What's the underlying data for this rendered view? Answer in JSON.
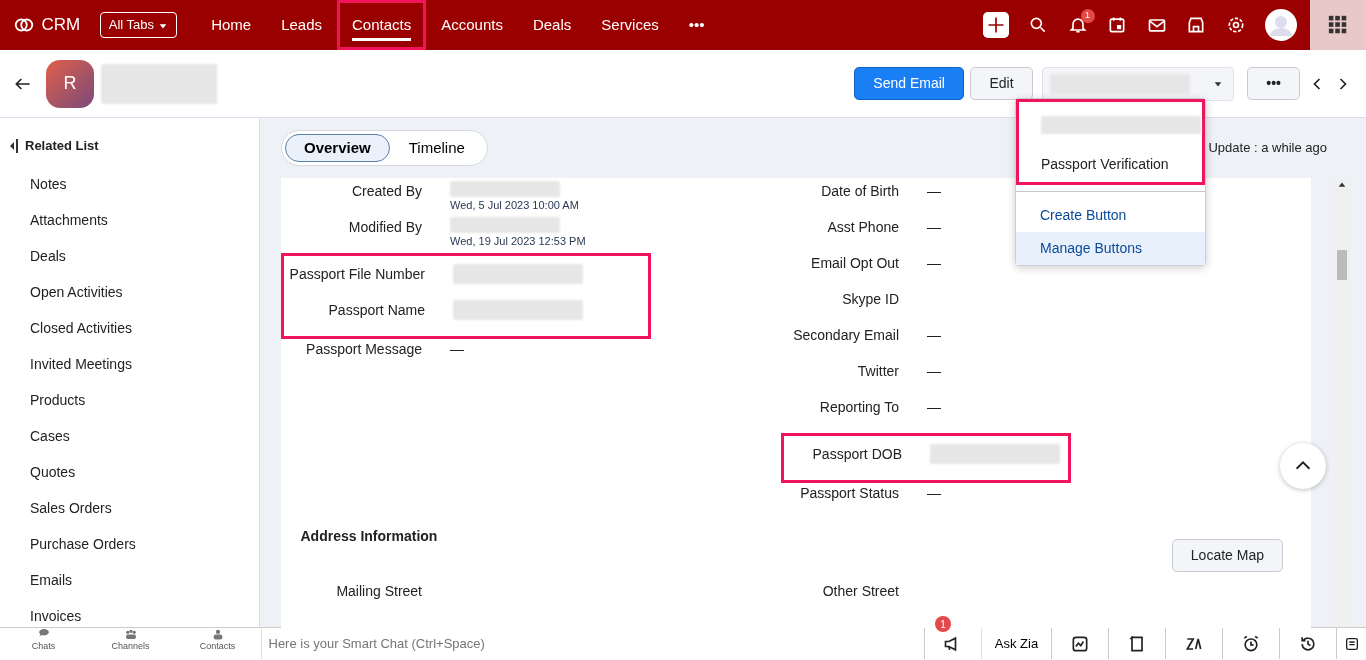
{
  "app": {
    "name": "CRM",
    "all_tabs": "All Tabs",
    "more": "•••",
    "notification_count": "1"
  },
  "nav_tabs": [
    {
      "label": "Home",
      "selected": false,
      "highlighted": false
    },
    {
      "label": "Leads",
      "selected": false,
      "highlighted": false
    },
    {
      "label": "Contacts",
      "selected": true,
      "highlighted": true
    },
    {
      "label": "Accounts",
      "selected": false,
      "highlighted": false
    },
    {
      "label": "Deals",
      "selected": false,
      "highlighted": false
    },
    {
      "label": "Services",
      "selected": false,
      "highlighted": false
    }
  ],
  "record": {
    "avatar_letter": "R"
  },
  "actions": {
    "send_email": "Send Email",
    "edit": "Edit",
    "more": "•••"
  },
  "dropdown": {
    "highlighted": true,
    "items": [
      {
        "kind": "redacted"
      },
      {
        "kind": "item",
        "label": "Passport Verification"
      }
    ],
    "footer": [
      {
        "label": "Create Button",
        "selected": false
      },
      {
        "label": "Manage Buttons",
        "selected": true
      }
    ]
  },
  "sidebar": {
    "title": "Related List",
    "items": [
      "Notes",
      "Attachments",
      "Deals",
      "Open Activities",
      "Closed Activities",
      "Invited Meetings",
      "Products",
      "Cases",
      "Quotes",
      "Sales Orders",
      "Purchase Orders",
      "Emails",
      "Invoices"
    ]
  },
  "view_tabs": [
    {
      "label": "Overview",
      "selected": true
    },
    {
      "label": "Timeline",
      "selected": false
    }
  ],
  "last_update": "Update : a while ago",
  "left_fields": [
    {
      "label": "Created By",
      "kind": "user",
      "date": "Wed, 5 Jul 2023 10:00 AM",
      "highlighted": false
    },
    {
      "label": "Modified By",
      "kind": "user",
      "date": "Wed, 19 Jul 2023 12:53 PM",
      "highlighted": false
    },
    {
      "label": "Passport File Number",
      "kind": "redacted",
      "highlighted": true
    },
    {
      "label": "Passport Name",
      "kind": "redacted",
      "highlighted": true
    },
    {
      "label": "Passport Message",
      "kind": "text",
      "value": "—",
      "highlighted": false
    }
  ],
  "right_fields": [
    {
      "label": "Date of Birth",
      "kind": "text",
      "value": "—",
      "highlighted": false
    },
    {
      "label": "Asst Phone",
      "kind": "text",
      "value": "—",
      "highlighted": false
    },
    {
      "label": "Email Opt Out",
      "kind": "text",
      "value": "—",
      "highlighted": false
    },
    {
      "label": "Skype ID",
      "kind": "empty",
      "highlighted": false
    },
    {
      "label": "Secondary Email",
      "kind": "text",
      "value": "—",
      "highlighted": false
    },
    {
      "label": "Twitter",
      "kind": "text",
      "value": "—",
      "highlighted": false
    },
    {
      "label": "Reporting To",
      "kind": "text",
      "value": "—",
      "highlighted": false
    },
    {
      "label": "Passport DOB",
      "kind": "redacted",
      "highlighted": true
    },
    {
      "label": "Passport Status",
      "kind": "text",
      "value": "—",
      "highlighted": false
    }
  ],
  "address": {
    "title": "Address Information",
    "locate_map": "Locate Map",
    "left_label": "Mailing Street",
    "right_label": "Other Street"
  },
  "bottom_bar": {
    "shortcuts": [
      "Chats",
      "Channels",
      "Contacts"
    ],
    "chat_placeholder": "Here is your Smart Chat (Ctrl+Space)",
    "announcement_count": "1",
    "ask_zia": "Ask Zia"
  }
}
